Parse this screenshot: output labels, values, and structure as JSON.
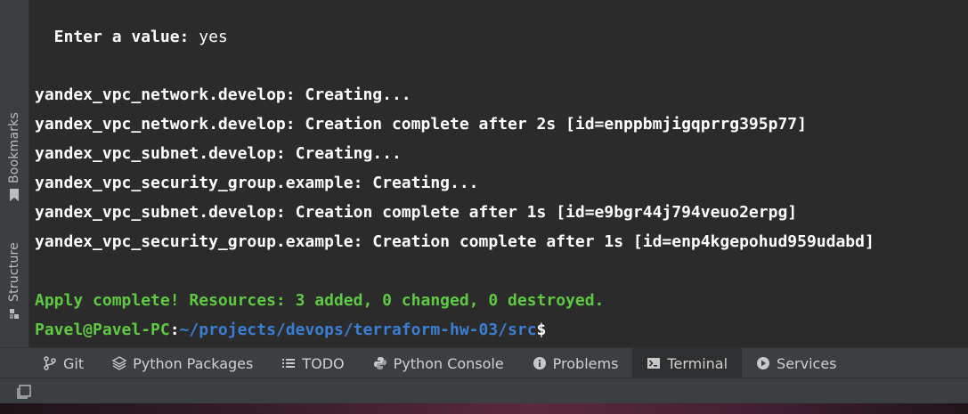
{
  "sidebar": {
    "tabs": [
      {
        "label": "Bookmarks",
        "icon": "bookmark-icon"
      },
      {
        "label": "Structure",
        "icon": "structure-icon"
      }
    ]
  },
  "terminal": {
    "prompt_line": {
      "label": "  Enter a value:",
      "value": " yes"
    },
    "output": [
      "yandex_vpc_network.develop: Creating...",
      "yandex_vpc_network.develop: Creation complete after 2s [id=enppbmjigqprrg395p77]",
      "yandex_vpc_subnet.develop: Creating...",
      "yandex_vpc_security_group.example: Creating...",
      "yandex_vpc_subnet.develop: Creation complete after 1s [id=e9bgr44j794veuo2erpg]",
      "yandex_vpc_security_group.example: Creation complete after 1s [id=enp4kgepohud959udabd]"
    ],
    "summary": "Apply complete! Resources: 3 added, 0 changed, 0 destroyed.",
    "shell_prompt": {
      "user_host": "Pavel@Pavel-PC",
      "separator": ":",
      "path": "~/projects/devops/terraform-hw-03/src",
      "symbol": "$"
    },
    "colors": {
      "success": "#5fc943",
      "path": "#3b7fd4",
      "text": "#ffffff",
      "background": "#2b2b2b"
    }
  },
  "tool_windows": {
    "tabs": [
      {
        "label": "Git",
        "icon": "git-branch-icon",
        "active": false
      },
      {
        "label": "Python Packages",
        "icon": "layers-icon",
        "active": false
      },
      {
        "label": "TODO",
        "icon": "list-icon",
        "active": false
      },
      {
        "label": "Python Console",
        "icon": "python-icon",
        "active": false
      },
      {
        "label": "Problems",
        "icon": "info-icon",
        "active": false
      },
      {
        "label": "Terminal",
        "icon": "terminal-icon",
        "active": true
      },
      {
        "label": "Services",
        "icon": "play-icon",
        "active": false
      }
    ]
  },
  "statusbar": {
    "toggle_icon": "toggle-tool-windows-icon"
  }
}
